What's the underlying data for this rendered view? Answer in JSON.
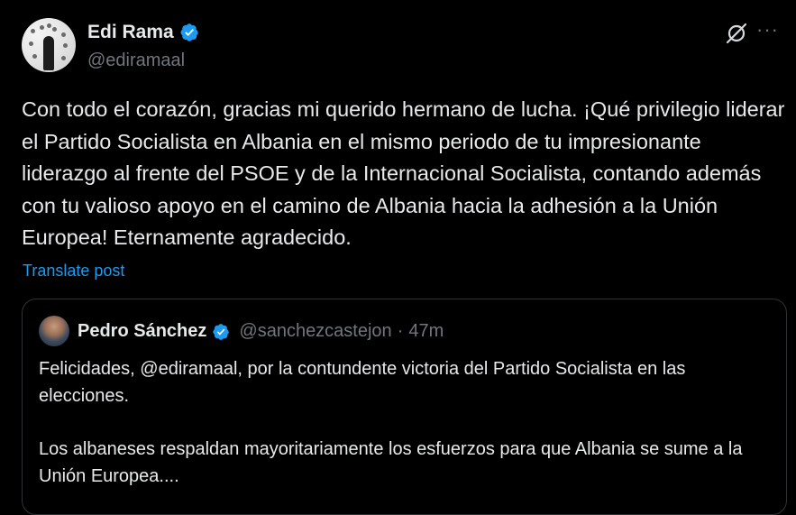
{
  "author": {
    "name": "Edi Rama",
    "handle": "@ediramaal",
    "verified_icon": "verified-badge-icon"
  },
  "actions": {
    "grok_icon": "grok-icon",
    "more_label": "···"
  },
  "tweet": {
    "text": "Con todo el corazón, gracias mi querido hermano de lucha. ¡Qué privilegio liderar el Partido Socialista en Albania en el mismo periodo de tu impresionante liderazgo al frente del PSOE y de la Internacional Socialista, contando además con tu valioso apoyo en el camino de Albania hacia la adhesión a la Unión Europea! Eternamente agradecido.",
    "translate_label": "Translate post"
  },
  "quoted": {
    "name": "Pedro Sánchez",
    "handle": "@sanchezcastejon",
    "separator": "·",
    "time": "47m",
    "paragraph1": "Felicidades, @ediramaal, por la contundente victoria del Partido Socialista en las elecciones.",
    "paragraph2": "Los albaneses respaldan mayoritariamente los esfuerzos para que Albania se sume a la Unión Europea...."
  },
  "colors": {
    "background": "#000000",
    "text": "#e7e9ea",
    "secondary": "#71767b",
    "link": "#1d9bf0",
    "verified": "#1d9bf0",
    "border": "#2f3336"
  }
}
